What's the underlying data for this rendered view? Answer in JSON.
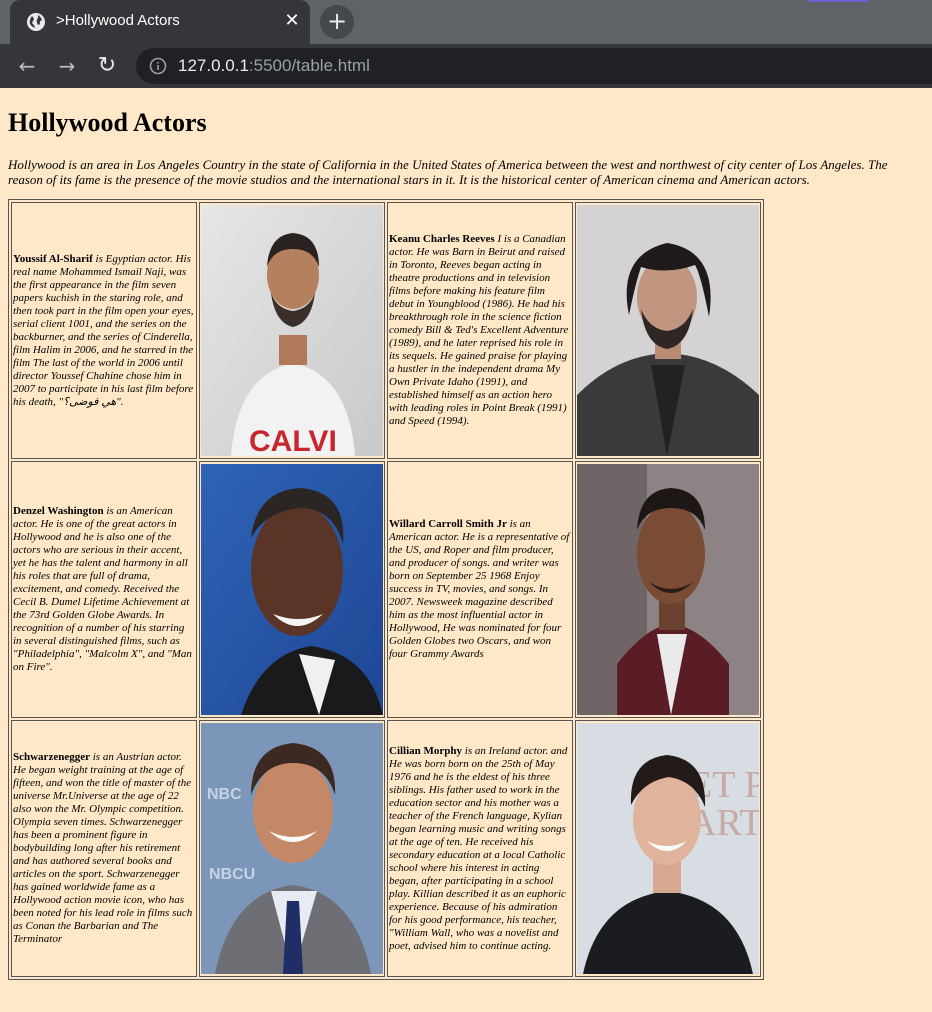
{
  "browser": {
    "tab_title": ">Hollywood Actors",
    "url_host": "127.0.0.1",
    "url_rest": ":5500/table.html"
  },
  "page": {
    "heading": "Hollywood Actors",
    "intro": "Hollywood is an area in Los Angeles Country in the state of California in the United States of America between the west and northwest of city center of Los Angeles. The reason of its fame is the presence of the movie studios and the international stars in it. It is the historical center of American cinema and American actors."
  },
  "actors": [
    {
      "name": "Youssif Al-Sharif",
      "bio": " is Egyptian actor. His real name Mohammed Ismail Naji, was the first appearance in the film seven papers kuchish in the staring role, and then took part in the film open your eyes, serial client 1001, and the series on the backburner, and the series of Cinderella, film Halim in 2006, and he starred in the film The last of the world in 2006 until director Youssef Chahine chose him in 2007 to participate in his last film before his death, \"هي فوضى؟\"."
    },
    {
      "name": "Keanu Charles Reeves",
      "bio": " I is a Canadian actor. He was Barn in Beirut and raised in Toronto, Reeves began acting in theatre productions and in television films before making his feature film debut in Youngblood (1986). He had his breakthrough role in the science fiction comedy Bill & Ted's Excellent Adventure (1989), and he later reprised his role in its sequels. He gained praise for playing a hustler in the independent drama My Own Private Idaho (1991), and established himself as an action hero with leading roles in Point Break (1991) and Speed (1994)."
    },
    {
      "name": "Denzel Washington",
      "bio": " is an American actor. He is one of the great actors in Hollywood and he is also one of the actors who are serious in their accent, yet he has the talent and harmony in all his roles that are full of drama, excitement, and comedy. Received the Cecil B. Dumel Lifetime Achievement at the 73rd Golden Globe Awards. In recognition of a number of his starring in several distinguished films, such as \"Philadelphia\", \"Malcolm X\", and \"Man on Fire\"."
    },
    {
      "name": "Willard Carroll Smith Jr",
      "bio": " is an American actor. He is a representative of the US, and Roper and film producer, and producer of songs. and writer was born on September 25 1968 Enjoy success in TV, movies, and songs. In 2007. Newsweek magazine described him as the most influential actor in Hollywood, He was nominated for four Golden Globes two Oscars, and won four Grammy Awards"
    },
    {
      "name": "Schwarzenegger",
      "bio": " is an Austrian actor. He began weight training at the age of fifteen, and won the title of master of the universe Mr.Universe at the age of 22 also won the Mr. Olympic competition. Olympia seven times. Schwarzenegger has been a prominent figure in bodybuilding long after his retirement and has authored several books and articles on the sport. Schwarzenegger has gained worldwide fame as a Hollywood action movie icon, who has been noted for his lead role in films such as Conan the Barbarian and The Terminator"
    },
    {
      "name": "Cillian Morphy",
      "bio": " is an Ireland actor. and He was born born on the 25th of May 1976 and he is the eldest of his three siblings. His father used to work in the education sector and his mother was a teacher of the French language, Kylian began learning music and writing songs at the age of ten. He received his secondary education at a local Catholic school where his interest in acting began, after participating in a school play. Killian described it as an euphoric experience. Because of his admiration for his good performance, his teacher, \"William Wall, who was a novelist and poet, advised him to continue acting."
    }
  ],
  "photo_backdrop_text": {
    "arnold": [
      "NBC",
      "NBCU"
    ],
    "cillian": [
      "ET P",
      "ART"
    ]
  },
  "shirt_text": "CALVI"
}
